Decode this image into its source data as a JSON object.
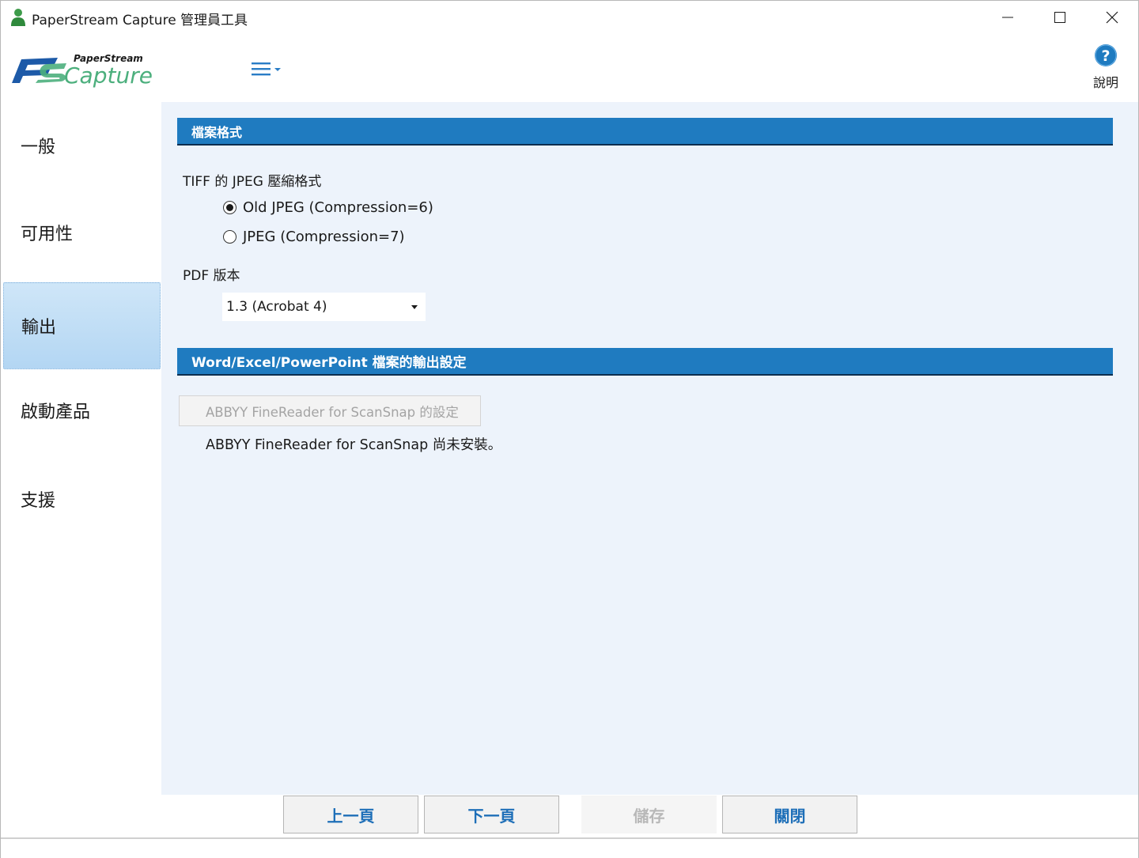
{
  "window": {
    "title": "PaperStream Capture 管理員工具"
  },
  "header": {
    "logo_top": "PaperStream",
    "logo_bottom": "Capture",
    "help_label": "說明"
  },
  "sidebar": {
    "items": [
      {
        "label": "一般"
      },
      {
        "label": "可用性"
      },
      {
        "label": "輸出",
        "active": true
      },
      {
        "label": "啟動產品"
      },
      {
        "label": "支援"
      }
    ]
  },
  "main": {
    "file_format": {
      "heading": "檔案格式",
      "tiff_label": "TIFF 的 JPEG 壓縮格式",
      "radio_options": [
        {
          "label": "Old JPEG (Compression=6)",
          "selected": true
        },
        {
          "label": "JPEG (Compression=7)",
          "selected": false
        }
      ],
      "pdf_label": "PDF 版本",
      "pdf_value": "1.3 (Acrobat 4)"
    },
    "office_output": {
      "heading": "Word/Excel/PowerPoint 檔案的輸出設定",
      "abbyy_button": "ABBYY FineReader for ScanSnap 的設定",
      "abbyy_status": "ABBYY FineReader for ScanSnap 尚未安裝。"
    }
  },
  "footer": {
    "prev": "上一頁",
    "next": "下一頁",
    "save": "儲存",
    "close": "關閉"
  },
  "colors": {
    "section_bar": "#1f7bc0",
    "accent_text": "#1e6fb8",
    "main_bg": "#edf3fb",
    "logo_green": "#4caf7d",
    "logo_blue": "#1d5aa8"
  }
}
